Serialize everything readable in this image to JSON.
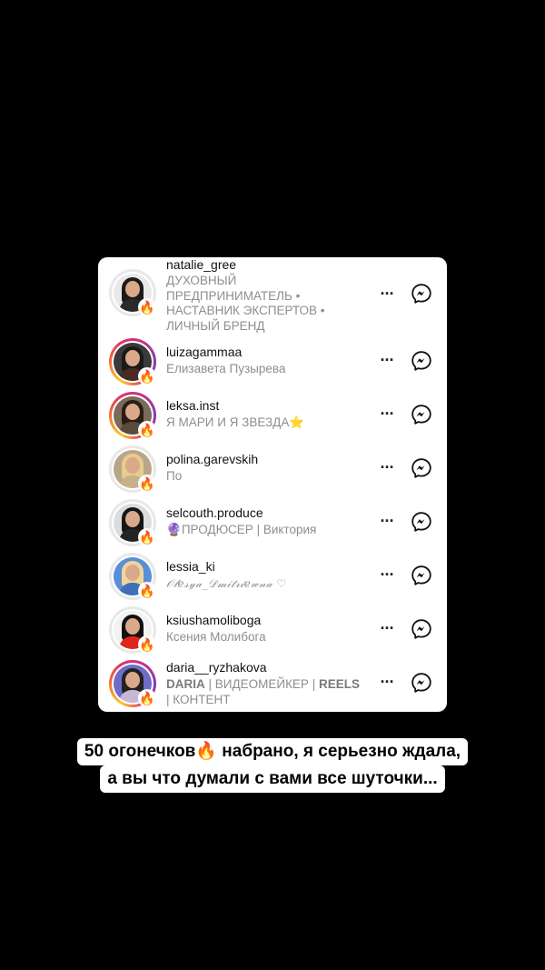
{
  "list": {
    "fire_icon": "🔥",
    "more_label": "···",
    "messenger_icon": "messenger-icon",
    "accounts": [
      {
        "username": "natalie_gree",
        "fullname_lines": [
          "ДУХОВНЫЙ",
          "ПРЕДПРИНИМАТЕЛЬ •",
          "НАСТАВНИК ЭКСПЕРТОВ •",
          "ЛИЧНЫЙ БРЕНД"
        ],
        "has_story": false,
        "photo": {
          "bg": "#e9e9e9",
          "hair": "#1b1b1b",
          "body": "#2a2a2a"
        }
      },
      {
        "username": "luizagammaa",
        "fullname": "Елизавета Пузырева",
        "has_story": true,
        "photo": {
          "bg": "#3a3a3a",
          "hair": "#1a1a1a",
          "body": "#4a2a22"
        }
      },
      {
        "username": "leksa.inst",
        "fullname": "Я МАРИ И Я ЗВЕЗДА",
        "fullname_emoji": "⭐",
        "has_story": true,
        "photo": {
          "bg": "#7a6a5a",
          "hair": "#2a1d14",
          "body": "#5b4b3b"
        }
      },
      {
        "username": "polina.garevskih",
        "fullname": "По",
        "has_story": false,
        "photo": {
          "bg": "#b9a68a",
          "hair": "#e6cc8e",
          "body": "#c7b08a"
        }
      },
      {
        "username": "selcouth.produce",
        "fullname": "ПРОДЮСЕР | Виктория",
        "fullname_emoji": "🔮",
        "has_story": false,
        "photo": {
          "bg": "#dcdcdc",
          "hair": "#161616",
          "body": "#242424"
        }
      },
      {
        "username": "lessia_ki",
        "fullname": "𝒪𝓁𝑒𝓈𝓎𝒶_𝒟𝓂𝒾𝓉𝓇𝒾𝑒𝓌𝓃𝒶 ♡",
        "has_story": false,
        "photo": {
          "bg": "#5a8fd6",
          "hair": "#f0d59a",
          "body": "#3f6fb8"
        }
      },
      {
        "username": "ksiushamoliboga",
        "fullname": "Ксения Молибога",
        "has_story": false,
        "photo": {
          "bg": "#f2f2f2",
          "hair": "#111111",
          "body": "#e0241b"
        }
      },
      {
        "username": "daria__ryzhakova",
        "fullname_parts": [
          "DARIA",
          " | ВИДЕОМЕЙКЕР | ",
          "REELS"
        ],
        "fullname_line2": "| КОНТЕНТ",
        "has_story": true,
        "photo": {
          "bg": "#6f6cc9",
          "hair": "#222222",
          "body": "#c9b7d6"
        }
      }
    ]
  },
  "caption": {
    "line1": "50 огонечков🔥 набрано, я серьезно ждала,",
    "line2": "а вы что думали с вами все шуточки..."
  },
  "colors": {
    "background": "#000000",
    "card": "#ffffff",
    "username": "#111111",
    "secondary": "#8e8e8e"
  }
}
